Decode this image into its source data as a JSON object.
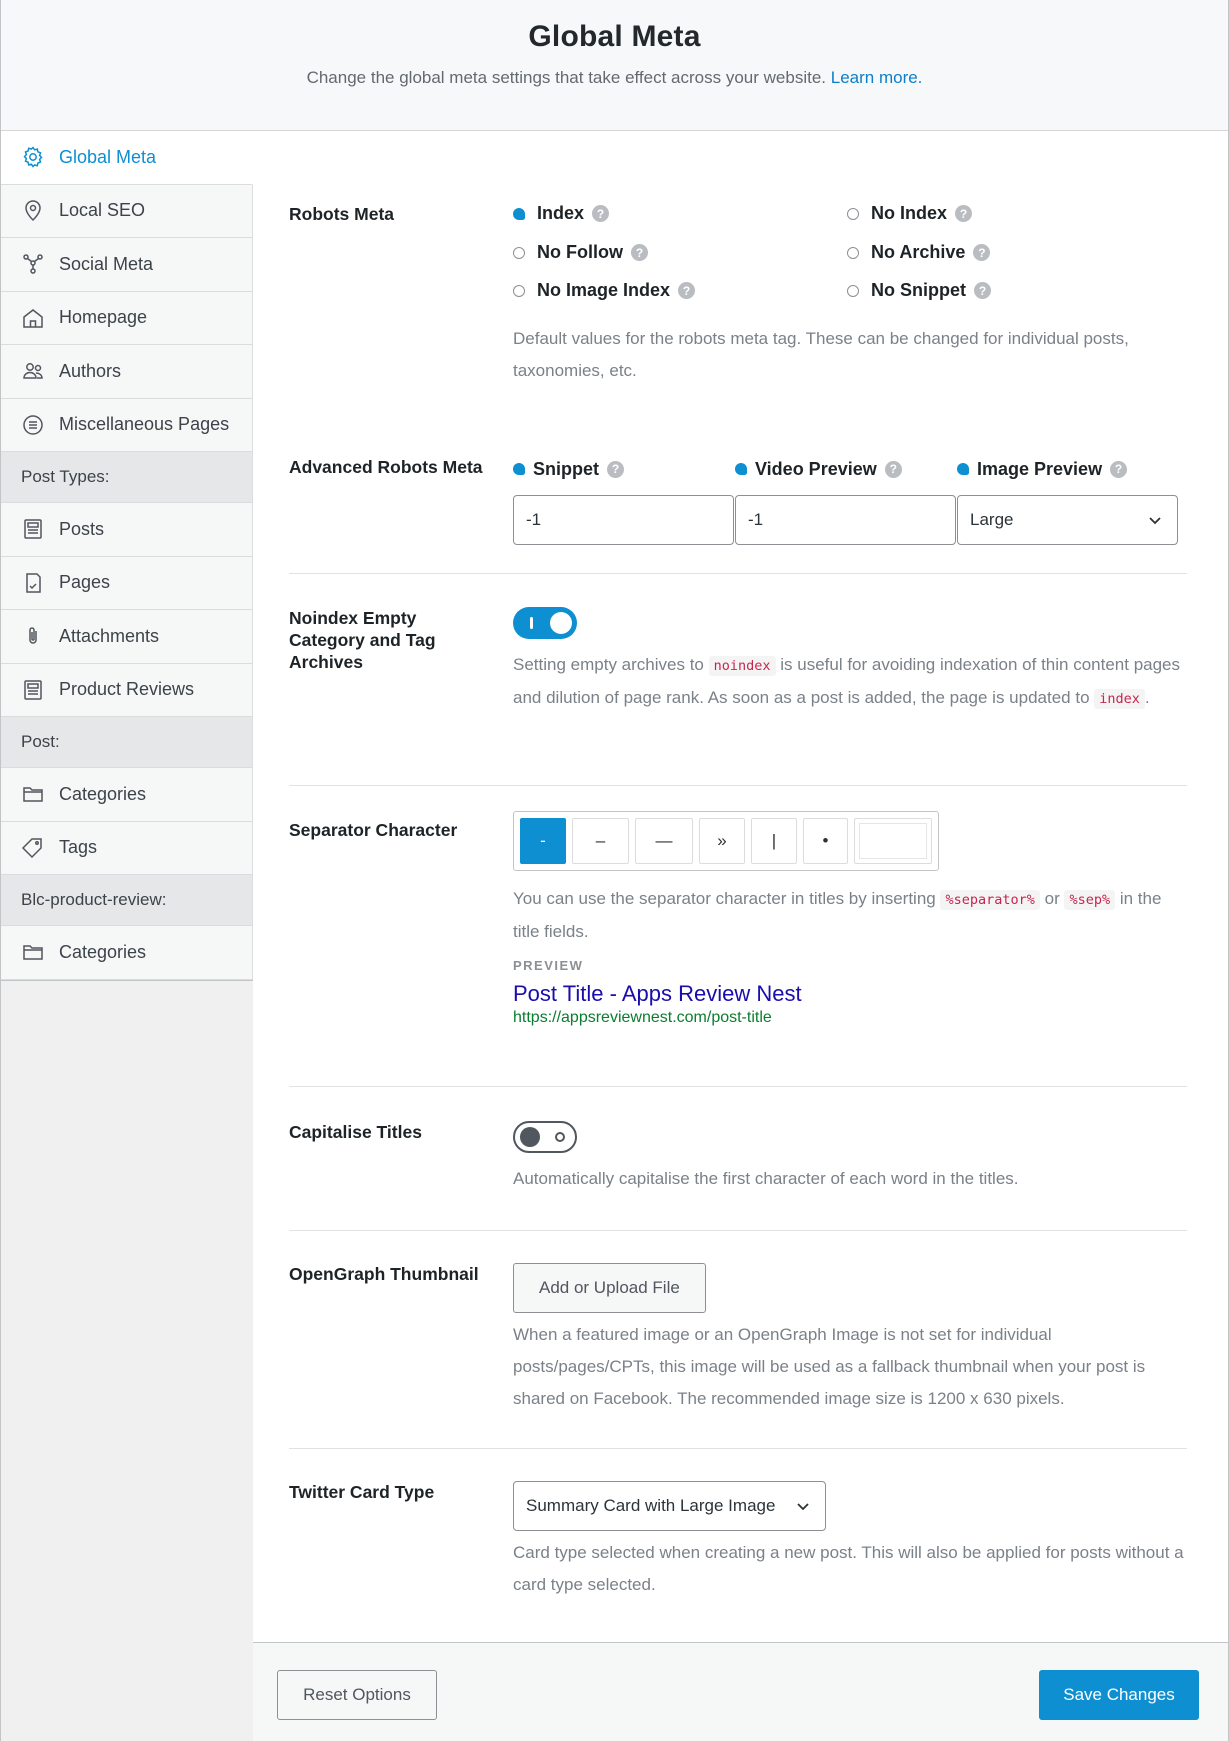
{
  "header": {
    "title": "Global Meta",
    "subtitle": "Change the global meta settings that take effect across your website.",
    "learn_more": "Learn more."
  },
  "sidebar": {
    "items": [
      {
        "label": "Global Meta",
        "icon": "gear-icon"
      },
      {
        "label": "Local SEO",
        "icon": "location-pin-icon"
      },
      {
        "label": "Social Meta",
        "icon": "share-network-icon"
      },
      {
        "label": "Homepage",
        "icon": "home-icon"
      },
      {
        "label": "Authors",
        "icon": "users-icon"
      },
      {
        "label": "Miscellaneous Pages",
        "icon": "list-circle-icon"
      }
    ],
    "group_post_types": "Post Types:",
    "post_types": [
      {
        "label": "Posts",
        "icon": "document-icon"
      },
      {
        "label": "Pages",
        "icon": "page-icon"
      },
      {
        "label": "Attachments",
        "icon": "paperclip-icon"
      },
      {
        "label": "Product Reviews",
        "icon": "document-icon"
      }
    ],
    "group_post": "Post:",
    "post": [
      {
        "label": "Categories",
        "icon": "folder-icon"
      },
      {
        "label": "Tags",
        "icon": "tag-icon"
      }
    ],
    "group_review": "Blc-product-review:",
    "review": [
      {
        "label": "Categories",
        "icon": "folder-icon"
      }
    ]
  },
  "robots": {
    "label": "Robots Meta",
    "options": [
      {
        "label": "Index",
        "checked": true
      },
      {
        "label": "No Index",
        "checked": false
      },
      {
        "label": "No Follow",
        "checked": false
      },
      {
        "label": "No Archive",
        "checked": false
      },
      {
        "label": "No Image Index",
        "checked": false
      },
      {
        "label": "No Snippet",
        "checked": false
      }
    ],
    "help": "?",
    "desc": "Default values for the robots meta tag. These can be changed for individual posts, taxonomies, etc."
  },
  "advanced": {
    "label": "Advanced Robots Meta",
    "snippet_label": "Snippet",
    "snippet_value": "-1",
    "video_label": "Video Preview",
    "video_value": "-1",
    "image_label": "Image Preview",
    "image_value": "Large"
  },
  "noindex_empty": {
    "label": "Noindex Empty Category and Tag Archives",
    "enabled": true,
    "desc_1": "Setting empty archives to",
    "code_1": "noindex",
    "desc_2": "is useful for avoiding indexation of thin content pages and dilution of page rank. As soon as a post is added, the page is updated to",
    "code_2": "index",
    "desc_3": "."
  },
  "separator": {
    "label": "Separator Character",
    "options": [
      "-",
      "–",
      "—",
      "»",
      "|",
      "•"
    ],
    "selected": "-",
    "desc_1": "You can use the separator character in titles by inserting",
    "code_1": "%separator%",
    "desc_or": "or",
    "code_2": "%sep%",
    "desc_2": "in the title fields.",
    "preview_label": "PREVIEW",
    "preview_title": "Post Title - Apps Review Nest",
    "preview_url": "https://appsreviewnest.com/post-title"
  },
  "capitalise": {
    "label": "Capitalise Titles",
    "enabled": false,
    "desc": "Automatically capitalise the first character of each word in the titles."
  },
  "opengraph": {
    "label": "OpenGraph Thumbnail",
    "button": "Add or Upload File",
    "desc": "When a featured image or an OpenGraph Image is not set for individual posts/pages/CPTs, this image will be used as a fallback thumbnail when your post is shared on Facebook. The recommended image size is 1200 x 630 pixels."
  },
  "twitter": {
    "label": "Twitter Card Type",
    "value": "Summary Card with Large Image",
    "desc": "Card type selected when creating a new post. This will also be applied for posts without a card type selected."
  },
  "footer": {
    "reset": "Reset Options",
    "save": "Save Changes"
  },
  "colors": {
    "accent": "#0d8fd1",
    "link": "#0d7ec9",
    "code": "#c7254e",
    "preview_title": "#1a0dab",
    "preview_url": "#0b7d2e"
  }
}
